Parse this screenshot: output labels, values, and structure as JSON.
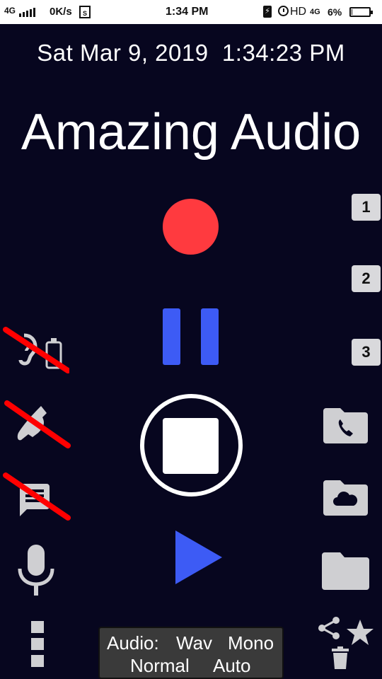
{
  "status_bar": {
    "network": "4G",
    "speed": "0K/s",
    "sd_icon": "S",
    "time": "1:34 PM",
    "hd": "HD",
    "network_right": "4G",
    "battery_percent": "6%",
    "battery_level": 0.06
  },
  "datetime": "Sat Mar 9, 2019  1:34:23 PM",
  "title": "Amazing Audio",
  "controls": {
    "record": "record-button",
    "pause": "pause-button",
    "stop": "stop-button",
    "play": "play-button"
  },
  "slots": [
    "1",
    "2",
    "3"
  ],
  "info": {
    "audio_label": "Audio:",
    "format": "Wav",
    "channels": "Mono",
    "quality": "Normal",
    "mode": "Auto"
  },
  "colors": {
    "background": "#07061f",
    "record": "#ff3a3f",
    "accent_blue": "#3d5bf5",
    "disabled_slash": "#ff0000",
    "icon_gray": "#cfcfd2"
  },
  "icons": {
    "left": [
      "hearing-phone-disabled-icon",
      "phone-disabled-icon",
      "message-disabled-icon",
      "microphone-icon",
      "more-menu-icon"
    ],
    "right": [
      "phone-folder-icon",
      "cloud-folder-icon",
      "folder-icon",
      "share-icon",
      "star-icon",
      "trash-icon"
    ]
  }
}
